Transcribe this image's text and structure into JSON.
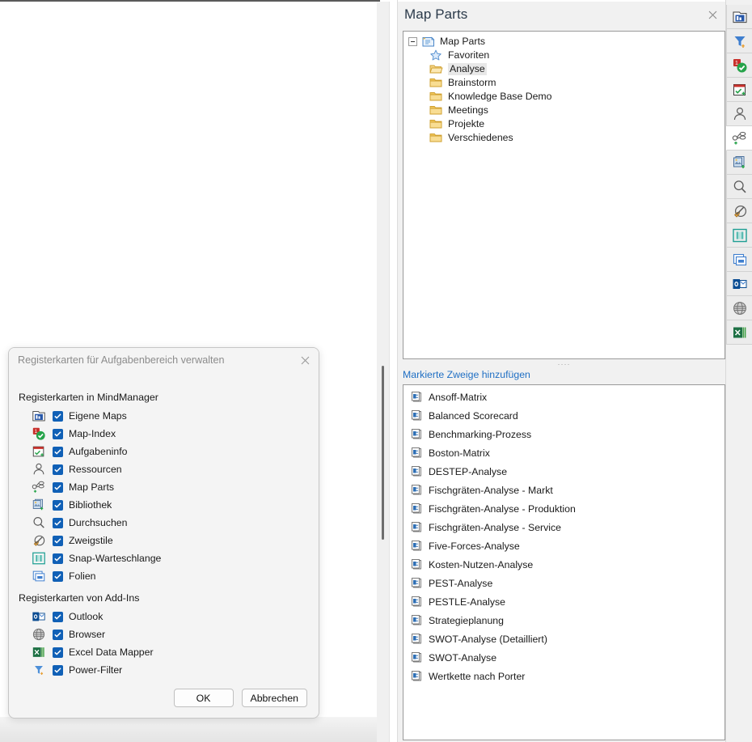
{
  "pane": {
    "title": "Map Parts",
    "close_label": "×",
    "add_link": "Markierte Zweige hinzufügen",
    "splitter_dots": "····",
    "tree": {
      "root": {
        "label": "Map Parts",
        "icon": "map-parts-root-icon",
        "expanded": true
      },
      "children": [
        {
          "label": "Favoriten",
          "icon": "star-icon",
          "selected": false
        },
        {
          "label": "Analyse",
          "icon": "folder-open-icon",
          "selected": true
        },
        {
          "label": "Brainstorm",
          "icon": "folder-icon",
          "selected": false
        },
        {
          "label": "Knowledge Base Demo",
          "icon": "folder-icon",
          "selected": false
        },
        {
          "label": "Meetings",
          "icon": "folder-icon",
          "selected": false
        },
        {
          "label": "Projekte",
          "icon": "folder-icon",
          "selected": false
        },
        {
          "label": "Verschiedenes",
          "icon": "folder-icon",
          "selected": false
        }
      ]
    },
    "parts": [
      {
        "label": "Ansoff-Matrix",
        "icon": "map-part-icon"
      },
      {
        "label": "Balanced Scorecard",
        "icon": "map-part-icon"
      },
      {
        "label": "Benchmarking-Prozess",
        "icon": "map-part-icon"
      },
      {
        "label": "Boston-Matrix",
        "icon": "map-part-icon"
      },
      {
        "label": "DESTEP-Analyse",
        "icon": "map-part-icon"
      },
      {
        "label": "Fischgräten-Analyse - Markt",
        "icon": "map-part-icon"
      },
      {
        "label": "Fischgräten-Analyse - Produktion",
        "icon": "map-part-icon"
      },
      {
        "label": "Fischgräten-Analyse - Service",
        "icon": "map-part-icon"
      },
      {
        "label": "Five-Forces-Analyse",
        "icon": "map-part-icon"
      },
      {
        "label": "Kosten-Nutzen-Analyse",
        "icon": "map-part-icon"
      },
      {
        "label": "PEST-Analyse",
        "icon": "map-part-icon"
      },
      {
        "label": "PESTLE-Analyse",
        "icon": "map-part-icon"
      },
      {
        "label": "Strategieplanung",
        "icon": "map-part-icon"
      },
      {
        "label": "SWOT-Analyse (Detailliert)",
        "icon": "map-part-icon"
      },
      {
        "label": "SWOT-Analyse",
        "icon": "map-part-icon"
      },
      {
        "label": "Wertkette nach Porter",
        "icon": "map-part-icon"
      }
    ]
  },
  "rail": {
    "tabs": [
      {
        "name": "eigene-maps",
        "icon": "my-maps-icon",
        "active": false
      },
      {
        "name": "power-filter",
        "icon": "funnel-icon",
        "active": false
      },
      {
        "name": "map-index",
        "icon": "map-index-icon",
        "active": false
      },
      {
        "name": "aufgabeninfo",
        "icon": "calendar-check-icon",
        "active": false
      },
      {
        "name": "ressourcen",
        "icon": "person-icon",
        "active": false
      },
      {
        "name": "map-parts",
        "icon": "map-parts-icon",
        "active": true
      },
      {
        "name": "bibliothek",
        "icon": "library-icon",
        "active": false
      },
      {
        "name": "durchsuchen",
        "icon": "magnifier-icon",
        "active": false
      },
      {
        "name": "zweigstile",
        "icon": "brush-circle-icon",
        "active": false
      },
      {
        "name": "snap-warteschlange",
        "icon": "snap-queue-icon",
        "active": false
      },
      {
        "name": "folien",
        "icon": "slides-icon",
        "active": false
      },
      {
        "name": "outlook",
        "icon": "outlook-icon",
        "active": false
      },
      {
        "name": "browser",
        "icon": "globe-icon",
        "active": false
      },
      {
        "name": "excel-data-mapper",
        "icon": "excel-icon",
        "active": false
      }
    ]
  },
  "dialog": {
    "title": "Registerkarten für Aufgabenbereich verwalten",
    "close_label": "×",
    "section_mindmanager": "Registerkarten in MindManager",
    "section_addins": "Registerkarten von Add-Ins",
    "mindmanager_items": [
      {
        "label": "Eigene Maps",
        "icon": "my-maps-icon",
        "checked": true
      },
      {
        "label": "Map-Index",
        "icon": "map-index-icon",
        "checked": true
      },
      {
        "label": "Aufgabeninfo",
        "icon": "calendar-check-icon",
        "checked": true
      },
      {
        "label": "Ressourcen",
        "icon": "person-icon",
        "checked": true
      },
      {
        "label": "Map Parts",
        "icon": "map-parts-icon",
        "checked": true
      },
      {
        "label": "Bibliothek",
        "icon": "library-icon",
        "checked": true
      },
      {
        "label": "Durchsuchen",
        "icon": "magnifier-icon",
        "checked": true
      },
      {
        "label": "Zweigstile",
        "icon": "brush-circle-icon",
        "checked": true
      },
      {
        "label": "Snap-Warteschlange",
        "icon": "snap-queue-icon",
        "checked": true
      },
      {
        "label": "Folien",
        "icon": "slides-icon",
        "checked": true
      }
    ],
    "addin_items": [
      {
        "label": "Outlook",
        "icon": "outlook-icon",
        "checked": true
      },
      {
        "label": "Browser",
        "icon": "globe-icon",
        "checked": true
      },
      {
        "label": "Excel Data Mapper",
        "icon": "excel-icon",
        "checked": true
      },
      {
        "label": "Power-Filter",
        "icon": "funnel-icon",
        "checked": true
      }
    ],
    "ok_label": "OK",
    "cancel_label": "Abbrechen"
  },
  "colors": {
    "accent_blue": "#1f6fc4",
    "checkbox_blue": "#1060b6",
    "pane_bg": "#f1f1f1",
    "dialog_bg": "#f4f4f4",
    "title_text": "#2b3a4a",
    "folder_yellow": "#e8b33a"
  }
}
